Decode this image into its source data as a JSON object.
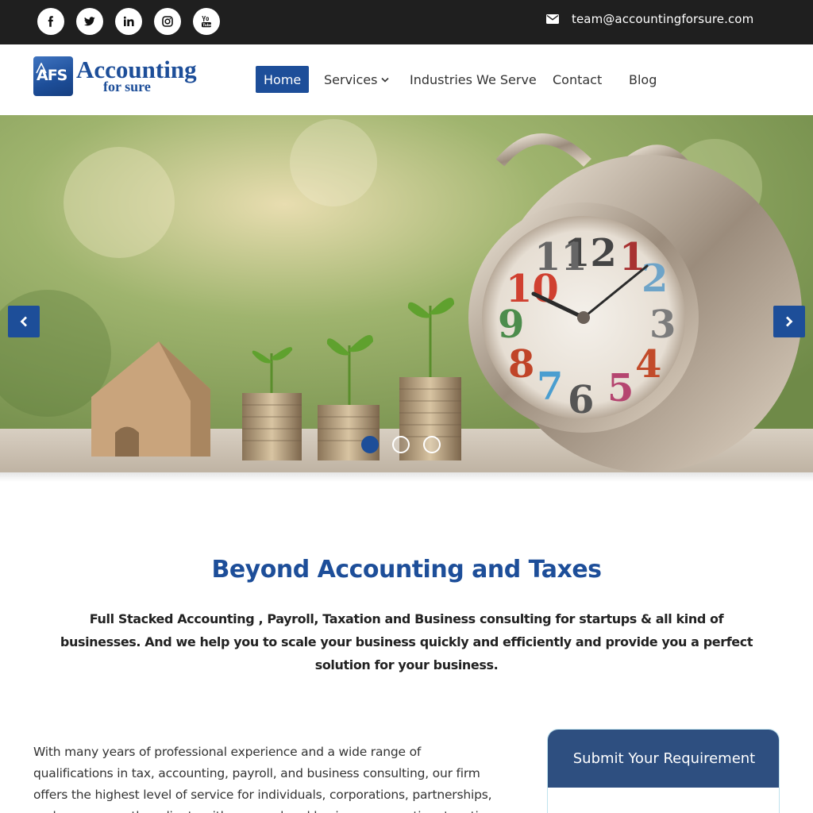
{
  "topbar": {
    "social": [
      {
        "icon": "facebook-icon"
      },
      {
        "icon": "twitter-icon"
      },
      {
        "icon": "linkedin-icon"
      },
      {
        "icon": "instagram-icon"
      },
      {
        "icon": "youtube-icon"
      }
    ],
    "email": "team@accountingforsure.com"
  },
  "logo": {
    "mark": "AFS",
    "word": "Accounting",
    "sub": "for sure"
  },
  "nav": {
    "items": [
      "Home",
      "Services",
      "Industries We Serve",
      "Contact",
      "Blog"
    ],
    "active": "Home"
  },
  "hero": {
    "slide_count": 3,
    "active_slide": 1
  },
  "intro": {
    "title": "Beyond Accounting and Taxes",
    "text": "Full Stacked Accounting , Payroll, Taxation and Business consulting for startups & all kind of businesses. And we help you to scale your business quickly and efficiently and provide you a perfect solution for your business."
  },
  "about": {
    "text": "With many years of professional experience and a wide range of qualifications in tax, accounting, payroll, and business consulting, our firm offers the highest level of service for individuals, corporations, partnerships, and numerous other clients with personal and business accounting, taxation, payroll and consulting needs."
  },
  "requirement": {
    "title": "Submit Your Requirement"
  },
  "colors": {
    "brand": "#1d4e99",
    "topbar": "#1f1f1f",
    "card_header": "#2e4f80"
  }
}
